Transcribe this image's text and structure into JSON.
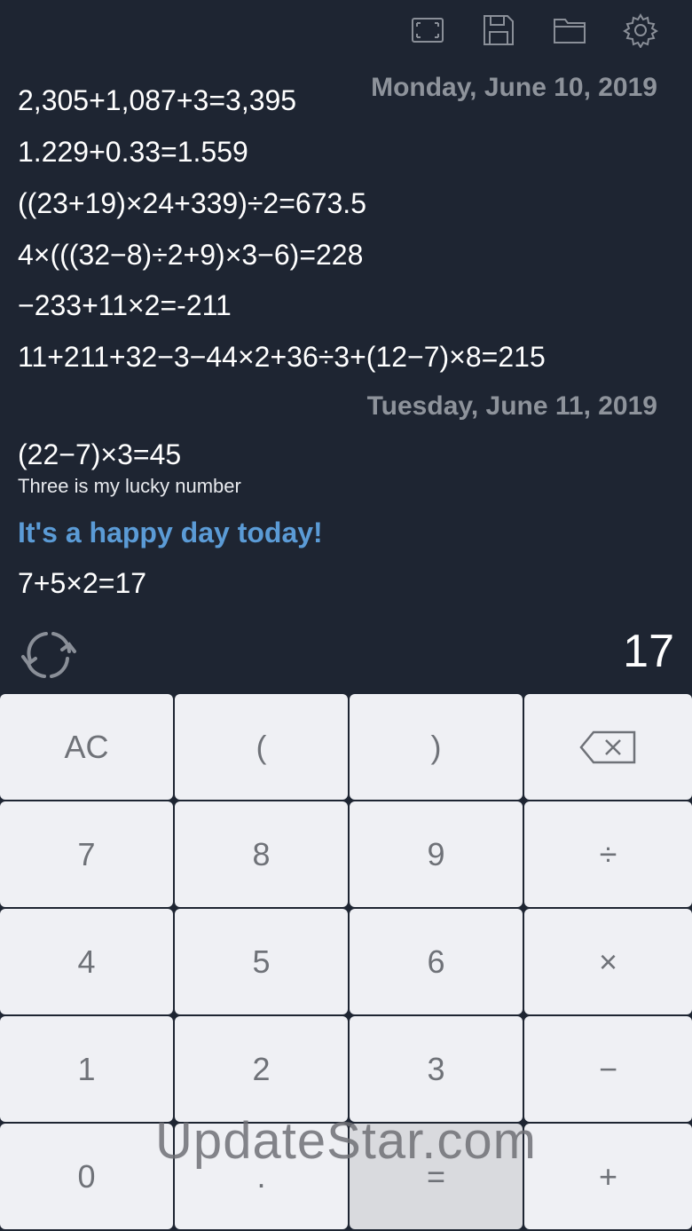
{
  "toolbar": {
    "icons": [
      "fullscreen-icon",
      "save-icon",
      "folder-icon",
      "gear-icon"
    ]
  },
  "history": {
    "days": [
      {
        "date": "Monday, June 10, 2019",
        "entries": [
          "2,305+1,087+3=3,395",
          "1.229+0.33=1.559",
          "((23+19)×24+339)÷2=673.5",
          "4×(((32−8)÷2+9)×3−6)=228",
          "−233+11×2=-211",
          "11+211+32−3−44×2+36÷3+(12−7)×8=215"
        ]
      },
      {
        "date": "Tuesday, June 11, 2019",
        "entry": "(22−7)×3=45",
        "note": "Three is my lucky number",
        "highlight": "It's a happy day today!",
        "last_entry": "7+5×2=17"
      }
    ]
  },
  "display": {
    "result": "17"
  },
  "keypad": {
    "keys": [
      "AC",
      "(",
      ")",
      "⌫",
      "7",
      "8",
      "9",
      "÷",
      "4",
      "5",
      "6",
      "×",
      "1",
      "2",
      "3",
      "−",
      "0",
      ".",
      "=",
      "+"
    ],
    "pressed_key": "="
  },
  "watermark": "UpdateStar.com",
  "colors": {
    "background": "#1e2532",
    "key": "#eff0f4",
    "accent_text": "#5b9bd6",
    "date": "#8e939b"
  }
}
